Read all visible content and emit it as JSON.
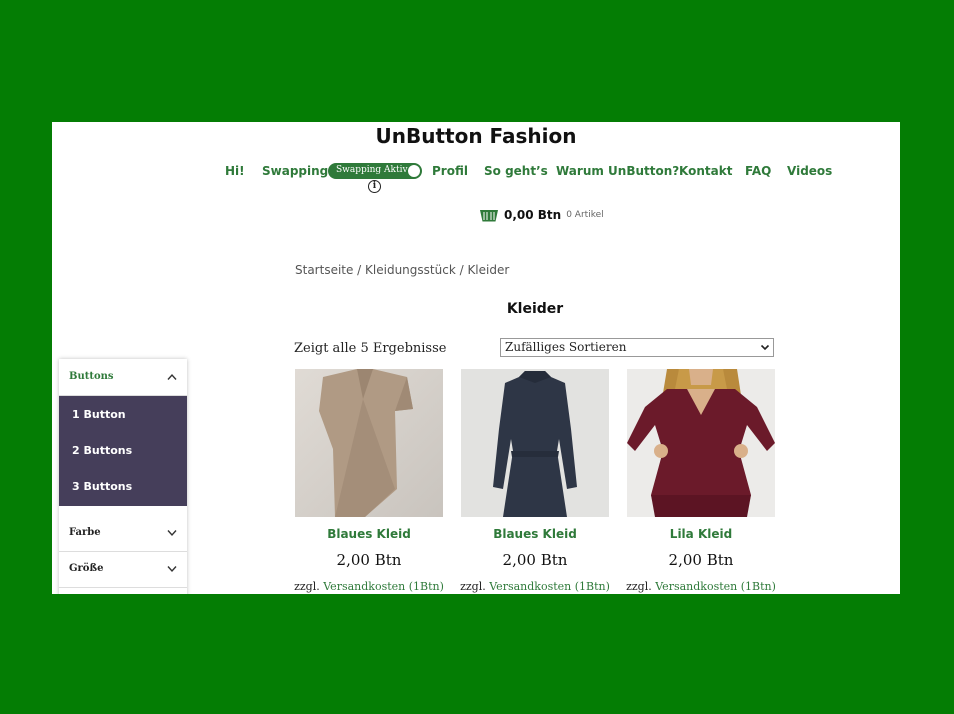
{
  "site": {
    "title": "UnButton Fashion"
  },
  "nav": {
    "items": [
      "Hi!",
      "Swapping",
      "Profil",
      "So geht’s",
      "Warum UnButton?",
      "Kontakt",
      "FAQ",
      "Videos"
    ],
    "toggle_label": "Swapping Aktiv",
    "info_glyph": "i"
  },
  "cart": {
    "total": "0,00 Btn",
    "count": "0 Artikel"
  },
  "breadcrumb": "Startseite / Kleidungsstück / Kleider",
  "page_title": "Kleider",
  "results_text": "Zeigt alle 5 Ergebnisse",
  "sort": {
    "selected": "Zufälliges Sortieren"
  },
  "filters": [
    {
      "title": "Buttons",
      "options": [
        "1 Button",
        "2 Buttons",
        "3 Buttons"
      ],
      "expanded": true
    },
    {
      "title": "Farbe",
      "expanded": false
    },
    {
      "title": "Größe",
      "expanded": false
    }
  ],
  "products": [
    {
      "name": "Blaues Kleid",
      "price": "2,00 Btn",
      "shipping_prefix": "zzgl.",
      "shipping_link": "Versandkosten (1Btn)"
    },
    {
      "name": "Blaues Kleid",
      "price": "2,00 Btn",
      "shipping_prefix": "zzgl.",
      "shipping_link": "Versandkosten (1Btn)"
    },
    {
      "name": "Lila Kleid",
      "price": "2,00 Btn",
      "shipping_prefix": "zzgl.",
      "shipping_link": "Versandkosten (1Btn)"
    }
  ],
  "colors": {
    "background": "#047d04",
    "accent": "#2f7a3a",
    "filter_panel": "#453e5a"
  },
  "icons": [
    "basket-icon",
    "info-icon",
    "chevron-up-icon",
    "chevron-down-icon"
  ]
}
